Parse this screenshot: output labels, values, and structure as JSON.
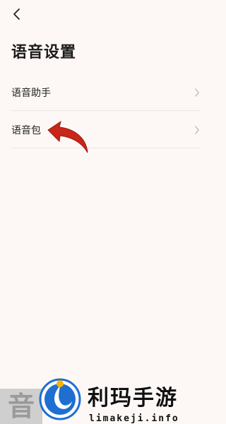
{
  "header": {
    "back_icon": "chevron-left-icon",
    "title": "语音设置"
  },
  "settings": {
    "items": [
      {
        "label": "语音助手",
        "icon": "chevron-right-icon"
      },
      {
        "label": "语音包",
        "icon": "chevron-right-icon"
      }
    ]
  },
  "annotation": {
    "icon": "curved-arrow-icon",
    "color": "#c8261a"
  },
  "watermark": {
    "partial_text": "音",
    "brand": "利玛手游",
    "domain": "limakeji.info",
    "logo_colors": [
      "#1e6fd1",
      "#f7b500"
    ]
  },
  "colors": {
    "background": "#fdf8f6",
    "divider": "#ece6e3",
    "chevron": "#b8b8b8"
  }
}
